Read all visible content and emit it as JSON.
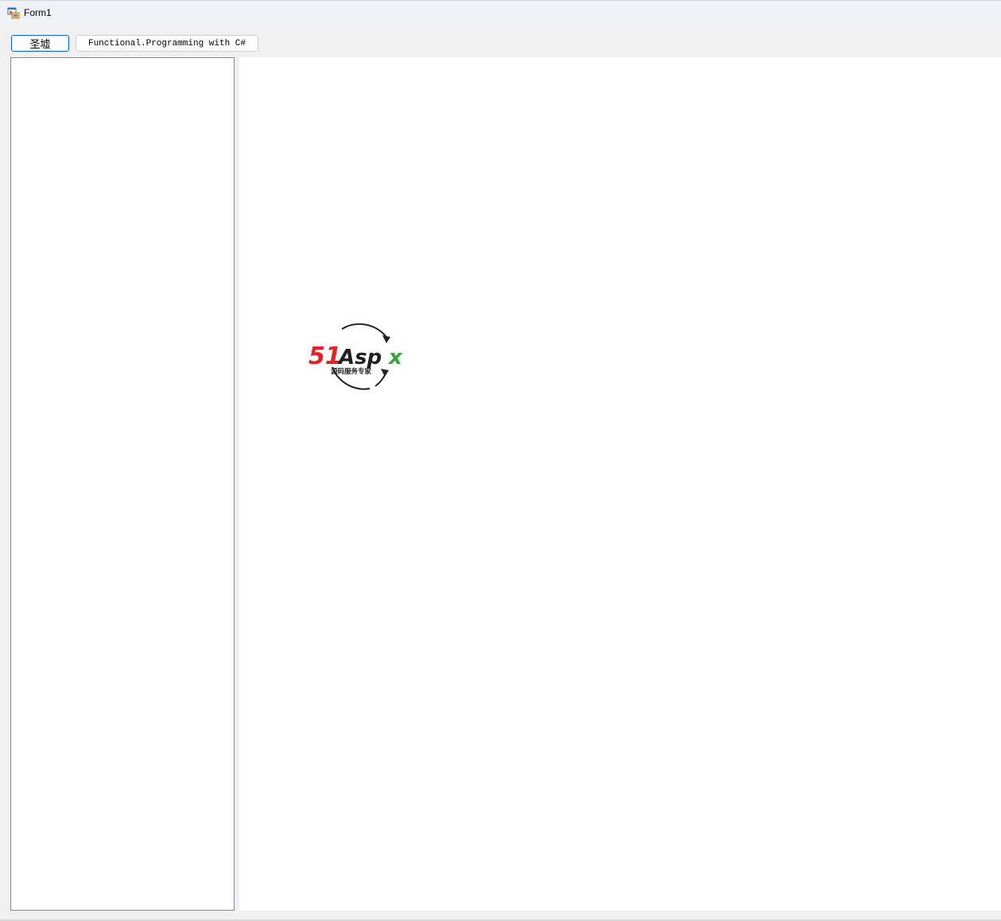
{
  "window": {
    "title": "Form1",
    "icon": "winforms-app-icon"
  },
  "toolbar": {
    "primary_button_label": "圣墟",
    "book_button_label": "Functional.Programming with C#"
  },
  "listbox": {
    "items": []
  },
  "picture": {
    "logo": {
      "main_text_red": "51",
      "main_text_dark": "Asp",
      "main_text_green": "x",
      "tagline": "源码服务专家"
    }
  },
  "colors": {
    "logo_red": "#e32226",
    "logo_green": "#34a63a",
    "logo_dark": "#231f20",
    "focus_border": "#0067c0"
  }
}
